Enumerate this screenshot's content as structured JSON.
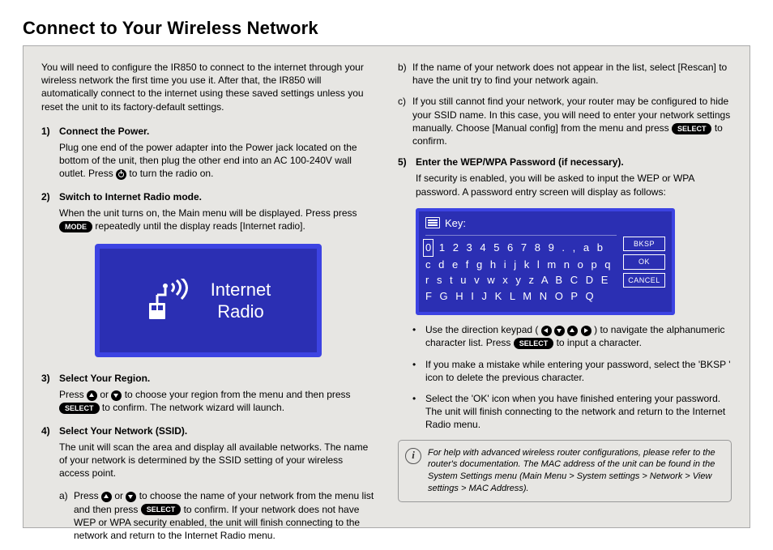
{
  "title": "Connect to Your Wireless Network",
  "intro": "You will need to configure the IR850 to connect to the internet through your wireless network the first time you use it. After that, the IR850 will automatically connect to the internet using these saved settings unless you reset the unit to its factory-default settings.",
  "steps": {
    "s1": {
      "num": "1)",
      "head": "Connect the Power.",
      "body_a": "Plug one end of the power adapter into the Power jack located on the bottom of the unit, then plug the other end into an AC 100-240V wall outlet. Press ",
      "body_b": " to turn the radio on."
    },
    "s2": {
      "num": "2)",
      "head": "Switch to Internet Radio mode.",
      "body_a": "When the unit turns on, the Main menu will be displayed. Press press ",
      "mode": "MODE",
      "body_b": " repeatedly until the display reads [Internet radio]."
    },
    "screen1": {
      "line1": "Internet",
      "line2": "Radio"
    },
    "s3": {
      "num": "3)",
      "head": "Select Your Region.",
      "body_a": "Press ",
      "body_mid": " or ",
      "body_b": " to choose your region from the menu and then press ",
      "select": "SELECT",
      "body_c": " to confirm. The network wizard will launch."
    },
    "s4": {
      "num": "4)",
      "head": "Select Your Network (SSID).",
      "body": "The unit will scan the area and display all available networks. The name of your network is determined by the SSID setting of your wireless access point.",
      "a_a": "Press ",
      "a_mid": " or ",
      "a_b": " to choose the name of your network from the menu list and then press ",
      "a_c": " to confirm. If your network does not have WEP or WPA security enabled, the unit will finish connecting to the network and return to the Internet Radio menu.",
      "b": "If the name of your network does not appear in the list, select [Rescan] to have the unit try to find your network again.",
      "c_a": "If you still cannot find your network, your router may be configured to hide your SSID name. In this case, you will need to enter your network settings manually. Choose [Manual config] from the menu and press ",
      "c_b": " to confirm."
    },
    "s5": {
      "num": "5)",
      "head": "Enter the WEP/WPA Password (if necessary).",
      "body": "If security is enabled, you will be asked to input the WEP or WPA password. A password entry screen will display as follows:"
    }
  },
  "keyscreen": {
    "header": "Key:",
    "row1_sel": "0",
    "row1_rest": " 1 2 3 4 5 6 7 8 9 . , a b",
    "row2": "c d e f g h i j k l m n o p q",
    "row3": "r s t u v w x y z A B C D E",
    "row4": "F G H I J K L M N O P Q",
    "btn_bksp": "BKSP",
    "btn_ok": "OK",
    "btn_cancel": "CANCEL"
  },
  "bullets": {
    "b1_a": "Use the direction keypad (",
    "b1_b": ") to navigate the alphanumeric character list. Press ",
    "b1_c": " to input a character.",
    "b2": "If you make a mistake while entering your password, select the 'BKSP ' icon to delete the previous character.",
    "b3": "Select the 'OK' icon when you have finished entering your password. The unit will finish connecting to the network and return to the Internet Radio menu."
  },
  "help": "For help with advanced wireless router configurations, please refer to the router's documentation. The MAC address of the unit can be found in the System Settings menu (Main Menu > System settings > Network > View settings > MAC Address).",
  "labels": {
    "select": "SELECT"
  }
}
